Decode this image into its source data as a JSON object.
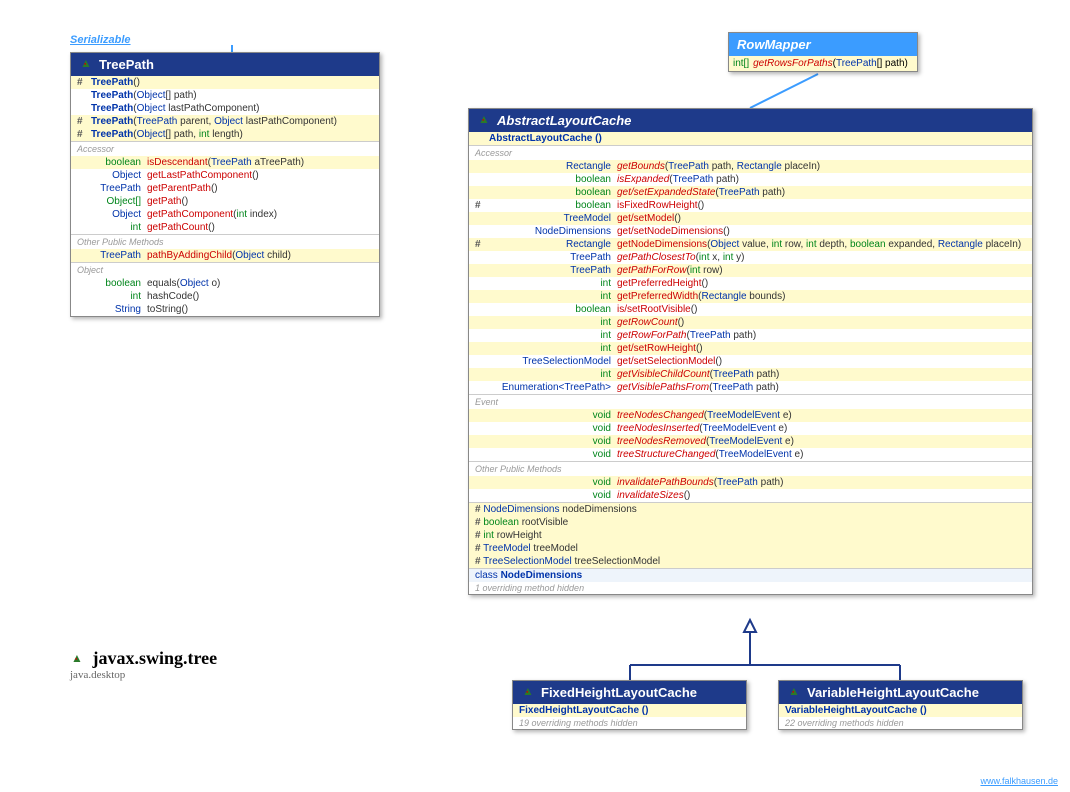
{
  "serializable": "Serializable",
  "package": {
    "name": "javax.swing.tree",
    "module": "java.desktop"
  },
  "footer": "www.falkhausen.de",
  "treepath": {
    "title": "TreePath",
    "ctors": [
      {
        "vis": "#",
        "sig": "TreePath ()",
        "yellow": true,
        "bold": true
      },
      {
        "vis": "",
        "sig": "TreePath (Object[] path)",
        "bold": true
      },
      {
        "vis": "",
        "sig": "TreePath (Object lastPathComponent)",
        "bold": true
      },
      {
        "vis": "#",
        "sig": "TreePath (TreePath parent, Object lastPathComponent)",
        "yellow": true,
        "bold": true
      },
      {
        "vis": "#",
        "sig": "TreePath (Object[] path, int length)",
        "yellow": true,
        "bold": true
      }
    ],
    "accessor_label": "Accessor",
    "accessor": [
      {
        "ret": "boolean",
        "retw": 56,
        "name": "isDescendant",
        "args": " (TreePath aTreePath)",
        "yellow": true
      },
      {
        "ret": "Object",
        "retw": 56,
        "name": "getLastPathComponent",
        "args": " ()"
      },
      {
        "ret": "TreePath",
        "retw": 56,
        "name": "getParentPath",
        "args": " ()"
      },
      {
        "ret": "Object[]",
        "retw": 56,
        "name": "getPath",
        "args": " ()"
      },
      {
        "ret": "Object",
        "retw": 56,
        "name": "getPathComponent",
        "args": " (int index)"
      },
      {
        "ret": "int",
        "retw": 56,
        "name": "getPathCount",
        "args": " ()"
      }
    ],
    "other_label": "Other Public Methods",
    "other": [
      {
        "ret": "TreePath",
        "retw": 56,
        "name": "pathByAddingChild",
        "args": " (Object child)",
        "yellow": true
      }
    ],
    "object_label": "Object",
    "object": [
      {
        "ret": "boolean",
        "retw": 56,
        "name": "equals",
        "args": " (Object o)",
        "namecolor": "#333"
      },
      {
        "ret": "int",
        "retw": 56,
        "name": "hashCode",
        "args": " ()",
        "namecolor": "#333"
      },
      {
        "ret": "String",
        "retw": 56,
        "name": "toString",
        "args": " ()",
        "namecolor": "#333"
      }
    ]
  },
  "rowmapper": {
    "title": "RowMapper",
    "ret": "int[]",
    "name": "getRowsForPaths",
    "args": " (TreePath[] path)"
  },
  "alc": {
    "title": "AbstractLayoutCache",
    "ctor": {
      "sig": "AbstractLayoutCache ()",
      "bold": true
    },
    "accessor_label": "Accessor",
    "accessor": [
      {
        "vis": "",
        "ret": "Rectangle",
        "name": "getBounds",
        "args": " (TreePath path, Rectangle placeIn)",
        "italic": true,
        "yellow": true
      },
      {
        "vis": "",
        "ret": "boolean",
        "name": "isExpanded",
        "args": " (TreePath path)",
        "italic": true
      },
      {
        "vis": "",
        "ret": "boolean",
        "name": "get/setExpandedState",
        "args": " (TreePath path)",
        "italic": true,
        "yellow": true
      },
      {
        "vis": "#",
        "ret": "boolean",
        "name": "isFixedRowHeight",
        "args": " ()"
      },
      {
        "vis": "",
        "ret": "TreeModel",
        "name": "get/setModel",
        "args": " ()",
        "yellow": true
      },
      {
        "vis": "",
        "ret": "NodeDimensions",
        "name": "get/setNodeDimensions",
        "args": " ()"
      },
      {
        "vis": "#",
        "ret": "Rectangle",
        "name": "getNodeDimensions",
        "args": " (Object value, int row, int depth, boolean expanded, Rectangle placeIn)",
        "yellow": true
      },
      {
        "vis": "",
        "ret": "TreePath",
        "name": "getPathClosestTo",
        "args": " (int x, int y)",
        "italic": true
      },
      {
        "vis": "",
        "ret": "TreePath",
        "name": "getPathForRow",
        "args": " (int row)",
        "italic": true,
        "yellow": true
      },
      {
        "vis": "",
        "ret": "int",
        "name": "getPreferredHeight",
        "args": " ()"
      },
      {
        "vis": "",
        "ret": "int",
        "name": "getPreferredWidth",
        "args": " (Rectangle bounds)",
        "yellow": true
      },
      {
        "vis": "",
        "ret": "boolean",
        "name": "is/setRootVisible",
        "args": " ()"
      },
      {
        "vis": "",
        "ret": "int",
        "name": "getRowCount",
        "args": " ()",
        "italic": true,
        "yellow": true
      },
      {
        "vis": "",
        "ret": "int",
        "name": "getRowForPath",
        "args": " (TreePath path)",
        "italic": true
      },
      {
        "vis": "",
        "ret": "int",
        "name": "get/setRowHeight",
        "args": " ()",
        "yellow": true
      },
      {
        "vis": "",
        "ret": "TreeSelectionModel",
        "name": "get/setSelectionModel",
        "args": " ()"
      },
      {
        "vis": "",
        "ret": "int",
        "name": "getVisibleChildCount",
        "args": " (TreePath path)",
        "italic": true,
        "yellow": true
      },
      {
        "vis": "",
        "ret": "Enumeration<TreePath>",
        "name": "getVisiblePathsFrom",
        "args": " (TreePath path)",
        "italic": true
      }
    ],
    "event_label": "Event",
    "event": [
      {
        "ret": "void",
        "name": "treeNodesChanged",
        "args": " (TreeModelEvent e)",
        "italic": true,
        "yellow": true
      },
      {
        "ret": "void",
        "name": "treeNodesInserted",
        "args": " (TreeModelEvent e)",
        "italic": true
      },
      {
        "ret": "void",
        "name": "treeNodesRemoved",
        "args": " (TreeModelEvent e)",
        "italic": true,
        "yellow": true
      },
      {
        "ret": "void",
        "name": "treeStructureChanged",
        "args": " (TreeModelEvent e)",
        "italic": true
      }
    ],
    "other_label": "Other Public Methods",
    "other": [
      {
        "ret": "void",
        "name": "invalidatePathBounds",
        "args": " (TreePath path)",
        "italic": true,
        "yellow": true
      },
      {
        "ret": "void",
        "name": "invalidateSizes",
        "args": " ()",
        "italic": true
      }
    ],
    "fields": [
      {
        "vis": "#",
        "type": "NodeDimensions",
        "name": "nodeDimensions"
      },
      {
        "vis": "#",
        "type": "boolean",
        "name": "rootVisible"
      },
      {
        "vis": "#",
        "type": "int",
        "name": "rowHeight"
      },
      {
        "vis": "#",
        "type": "TreeModel",
        "name": "treeModel"
      },
      {
        "vis": "#",
        "type": "TreeSelectionModel",
        "name": "treeSelectionModel"
      }
    ],
    "innerclass": {
      "prefix": "class",
      "name": "NodeDimensions"
    },
    "hidden": "1 overriding method hidden"
  },
  "fhlc": {
    "title": "FixedHeightLayoutCache",
    "ctor": "FixedHeightLayoutCache ()",
    "hidden": "19 overriding methods hidden"
  },
  "vhlc": {
    "title": "VariableHeightLayoutCache",
    "ctor": "VariableHeightLayoutCache ()",
    "hidden": "22 overriding methods hidden"
  }
}
